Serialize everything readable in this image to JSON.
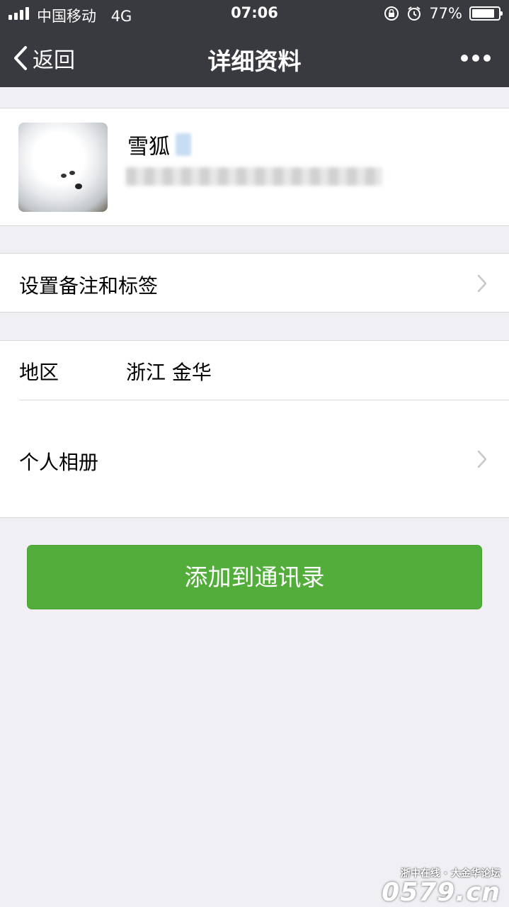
{
  "status_bar": {
    "carrier": "中国移动",
    "network": "4G",
    "time": "07:06",
    "battery_percent": "77%",
    "battery_level": 0.77
  },
  "nav": {
    "back_label": "返回",
    "title": "详细资料"
  },
  "profile": {
    "name": "雪狐"
  },
  "remark_row": {
    "label": "设置备注和标签"
  },
  "info": {
    "region_label": "地区",
    "region_value": "浙江 金华",
    "album_label": "个人相册"
  },
  "actions": {
    "add_contact_label": "添加到通讯录"
  },
  "watermark": {
    "tagline": "浙中在线 · 大金华论坛",
    "site": "0579.cn"
  },
  "colors": {
    "nav_bg": "#393a3f",
    "page_bg": "#efeff4",
    "button_green": "#52ad3a"
  }
}
